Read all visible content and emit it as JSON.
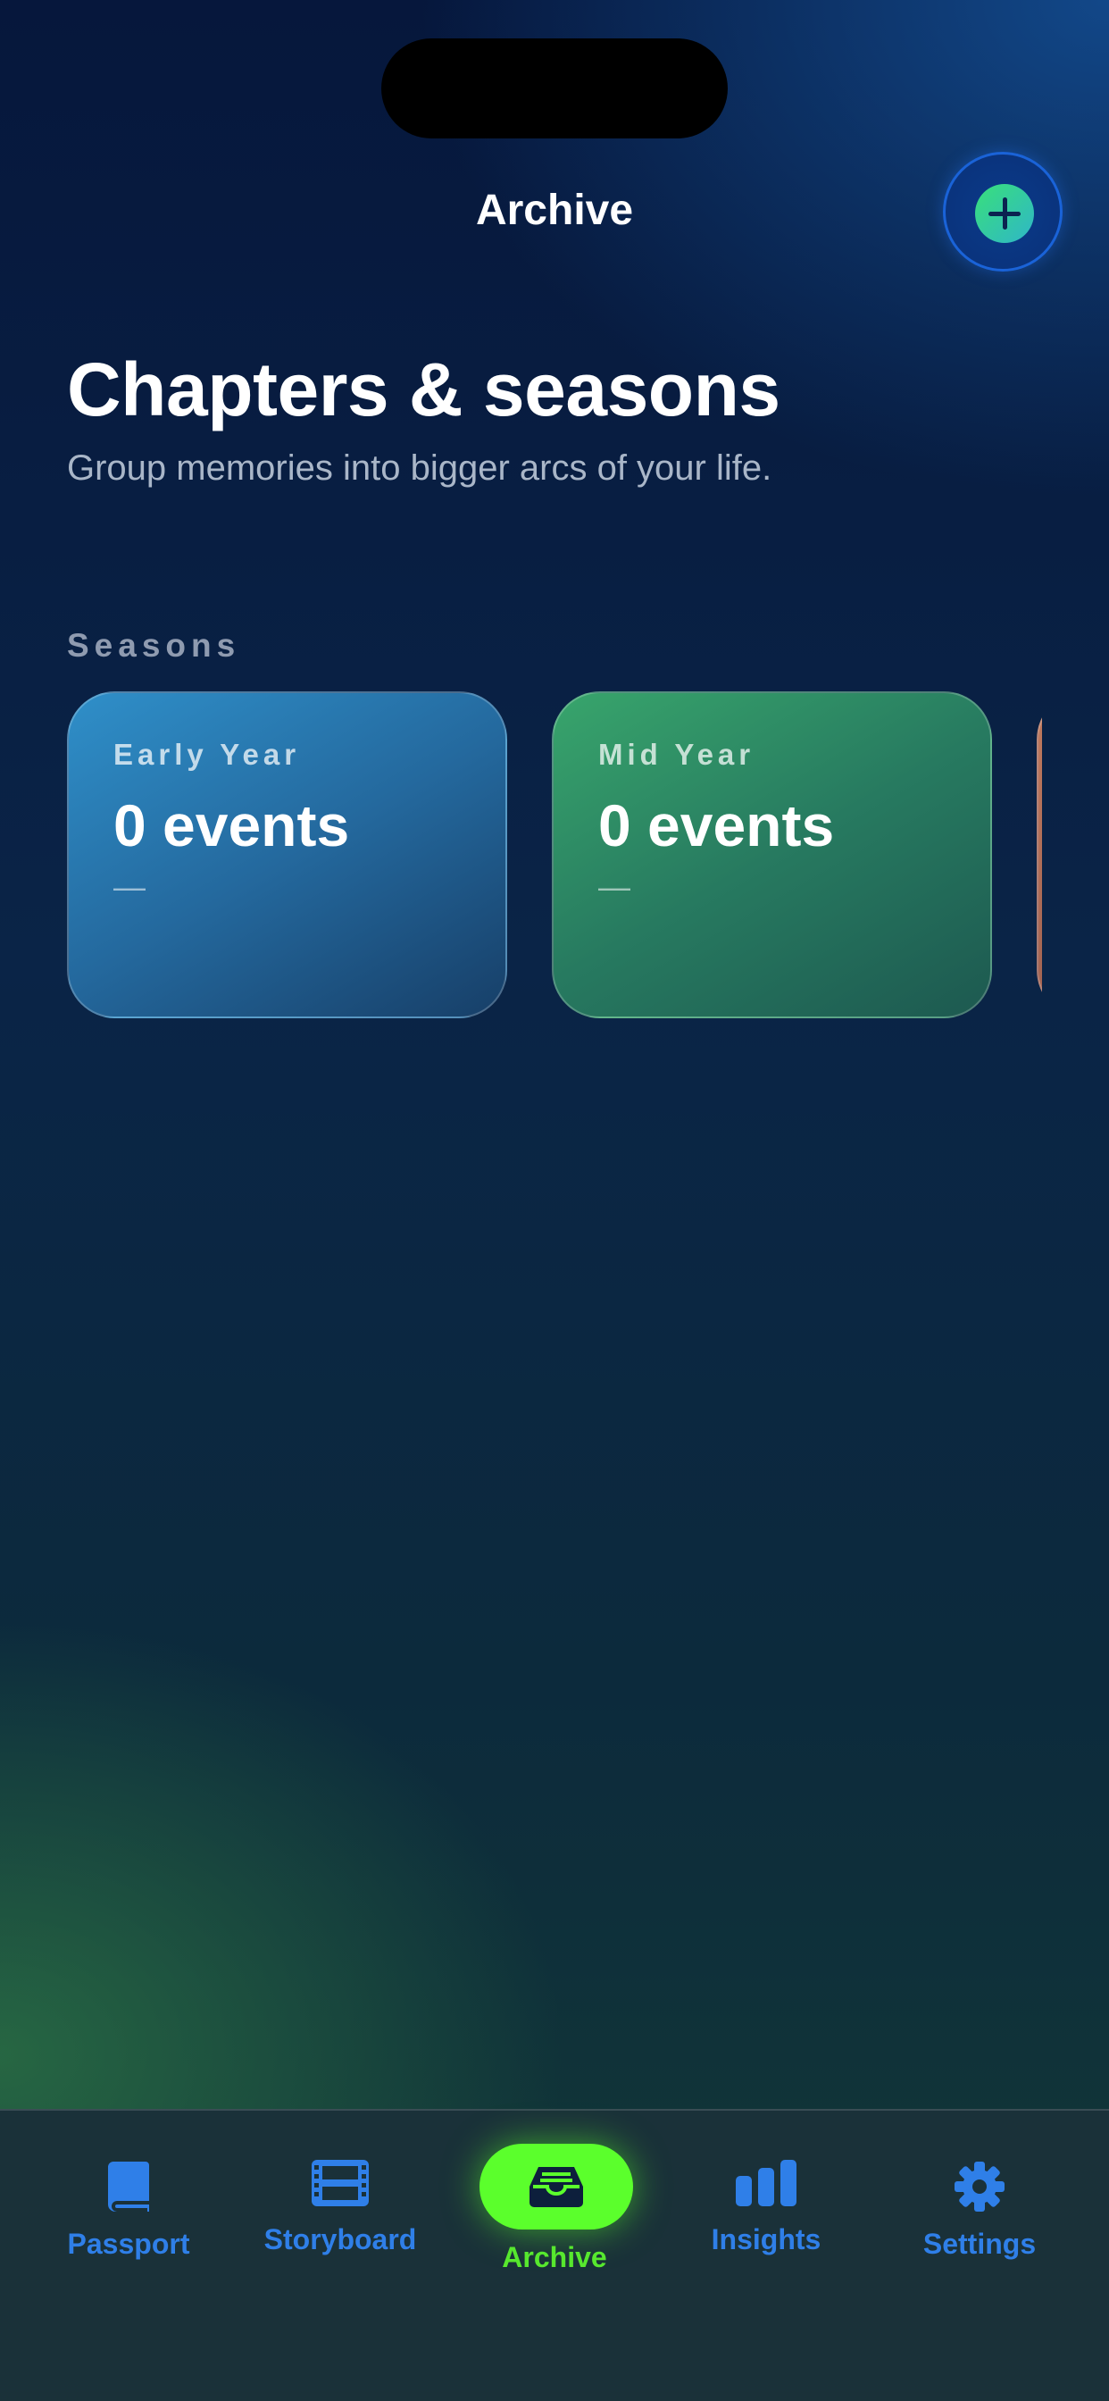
{
  "header": {
    "title": "Archive",
    "add_icon": "plus-circle-icon",
    "accent_color": "#1a63d8"
  },
  "page": {
    "heading": "Chapters & seasons",
    "subheading": "Group memories into bigger arcs of your life."
  },
  "seasons": {
    "label": "Seasons",
    "cards": [
      {
        "name": "Early Year",
        "count": "0 events",
        "detail": "—",
        "color": "#2f8fc9"
      },
      {
        "name": "Mid Year",
        "count": "0 events",
        "detail": "—",
        "color": "#38a56c"
      },
      {
        "color": "#c07a5e"
      }
    ]
  },
  "tab_bar": {
    "tabs": [
      {
        "label": "Passport",
        "icon": "book-icon",
        "active": false
      },
      {
        "label": "Storyboard",
        "icon": "film-icon",
        "active": false
      },
      {
        "label": "Archive",
        "icon": "tray-icon",
        "active": true
      },
      {
        "label": "Insights",
        "icon": "bar-chart-icon",
        "active": false
      },
      {
        "label": "Settings",
        "icon": "gear-icon",
        "active": false
      }
    ],
    "inactive_color": "#2f7fe8",
    "active_color": "#5bff2c"
  }
}
